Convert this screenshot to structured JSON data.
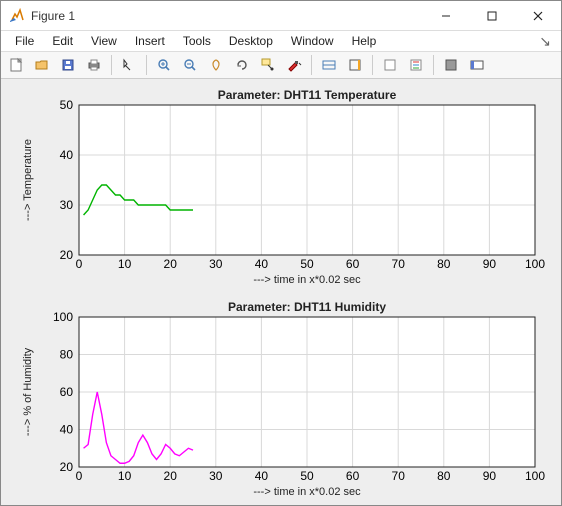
{
  "window": {
    "title": "Figure 1"
  },
  "menu": {
    "file": "File",
    "edit": "Edit",
    "view": "View",
    "insert": "Insert",
    "tools": "Tools",
    "desktop": "Desktop",
    "window": "Window",
    "help": "Help"
  },
  "chart_data": [
    {
      "type": "line",
      "title": "Parameter: DHT11 Temperature",
      "xlabel": "---> time in x*0.02 sec",
      "ylabel": "---> Temperature",
      "xlim": [
        0,
        100
      ],
      "ylim": [
        20,
        50
      ],
      "xticks": [
        0,
        10,
        20,
        30,
        40,
        50,
        60,
        70,
        80,
        90,
        100
      ],
      "yticks": [
        20,
        30,
        40,
        50
      ],
      "color": "#00b400",
      "x": [
        1,
        2,
        3,
        4,
        5,
        6,
        7,
        8,
        9,
        10,
        11,
        12,
        13,
        14,
        15,
        16,
        17,
        18,
        19,
        20,
        21,
        22,
        23,
        24,
        25
      ],
      "values": [
        28,
        29,
        31,
        33,
        34,
        34,
        33,
        32,
        32,
        31,
        31,
        31,
        30,
        30,
        30,
        30,
        30,
        30,
        30,
        29,
        29,
        29,
        29,
        29,
        29
      ]
    },
    {
      "type": "line",
      "title": "Parameter: DHT11 Humidity",
      "xlabel": "---> time in x*0.02 sec",
      "ylabel": "---> % of Humidity",
      "xlim": [
        0,
        100
      ],
      "ylim": [
        20,
        100
      ],
      "xticks": [
        0,
        10,
        20,
        30,
        40,
        50,
        60,
        70,
        80,
        90,
        100
      ],
      "yticks": [
        20,
        40,
        60,
        80,
        100
      ],
      "color": "#ff00ff",
      "x": [
        1,
        2,
        3,
        4,
        5,
        6,
        7,
        8,
        9,
        10,
        11,
        12,
        13,
        14,
        15,
        16,
        17,
        18,
        19,
        20,
        21,
        22,
        23,
        24,
        25
      ],
      "values": [
        30,
        32,
        48,
        60,
        48,
        33,
        26,
        24,
        22,
        22,
        23,
        26,
        33,
        37,
        33,
        27,
        24,
        27,
        32,
        30,
        27,
        26,
        28,
        30,
        29
      ]
    }
  ]
}
